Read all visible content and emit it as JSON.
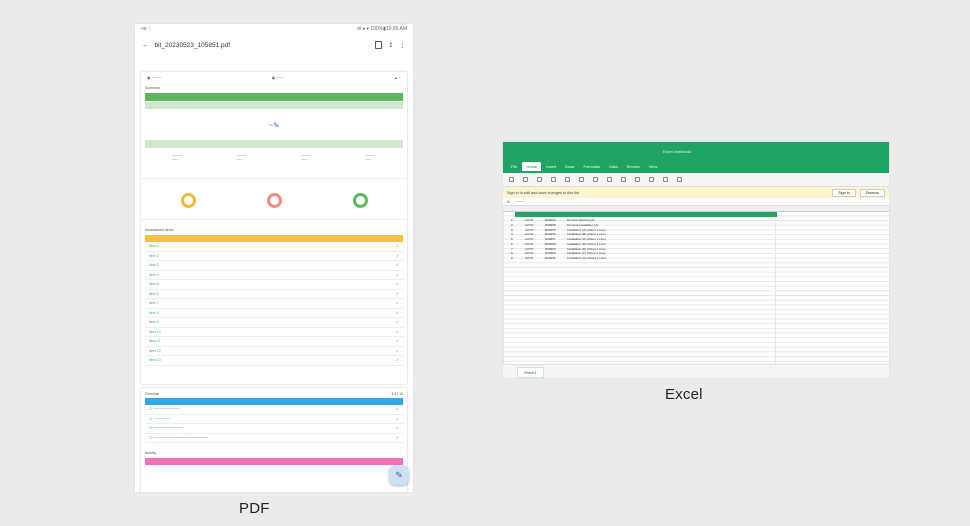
{
  "captions": {
    "pdf": "PDF",
    "excel": "Excel"
  },
  "pdf": {
    "status_left": "•≋  ⁝",
    "status_right": "✉ ⬧ ▾ 100%▮10:00 AM",
    "title": "bit_20230523_105851.pdf",
    "section1_title": "Summary",
    "section2_title": "Assessment items",
    "section3_title": "Checklist",
    "section4_title": "Activity",
    "checklist_value": "4.4 / 10",
    "assessment_items": [
      "Item 1",
      "Item 2",
      "Item 3",
      "Item 4",
      "Item 5",
      "Item 6",
      "Item 7",
      "Item 8",
      "Item 9",
      "Item 10",
      "Item 11",
      "Item 12",
      "Item 13"
    ]
  },
  "excel": {
    "title": "Excel workbook",
    "tabs": [
      "File",
      "Home",
      "Insert",
      "Draw",
      "Formulas",
      "Data",
      "Review",
      "View"
    ],
    "banner": "Sign in to edit and save changes to this file.",
    "sign_in": "Sign in",
    "dismiss": "Dismiss",
    "sheet_tab": "Sheet1",
    "rows": [
      [
        "1",
        "AUTO",
        "R00096",
        "Remote Opening (A)"
      ],
      [
        "2",
        "AUTO",
        "R00098",
        "Terminal Installation (A)"
      ],
      [
        "3",
        "AUTO",
        "R00055",
        "Installation (A) (Client 1 Line)"
      ],
      [
        "4",
        "AUTO",
        "R00056",
        "Installation (B) (Client 1 Line)"
      ],
      [
        "5",
        "AUTO",
        "R00057",
        "Installation (C) (Client 1 Line)"
      ],
      [
        "6",
        "AUTO",
        "R00058",
        "Installation (D) (Client 1 Line)"
      ],
      [
        "7",
        "AUTO",
        "R00059",
        "Installation (E) (Client 1 Line)"
      ],
      [
        "8",
        "AUTO",
        "R00060",
        "Installation (F) (Client 1 Line)"
      ],
      [
        "9",
        "AUTO",
        "R00061",
        "Installation (G) (Client 1 Line)"
      ]
    ]
  }
}
